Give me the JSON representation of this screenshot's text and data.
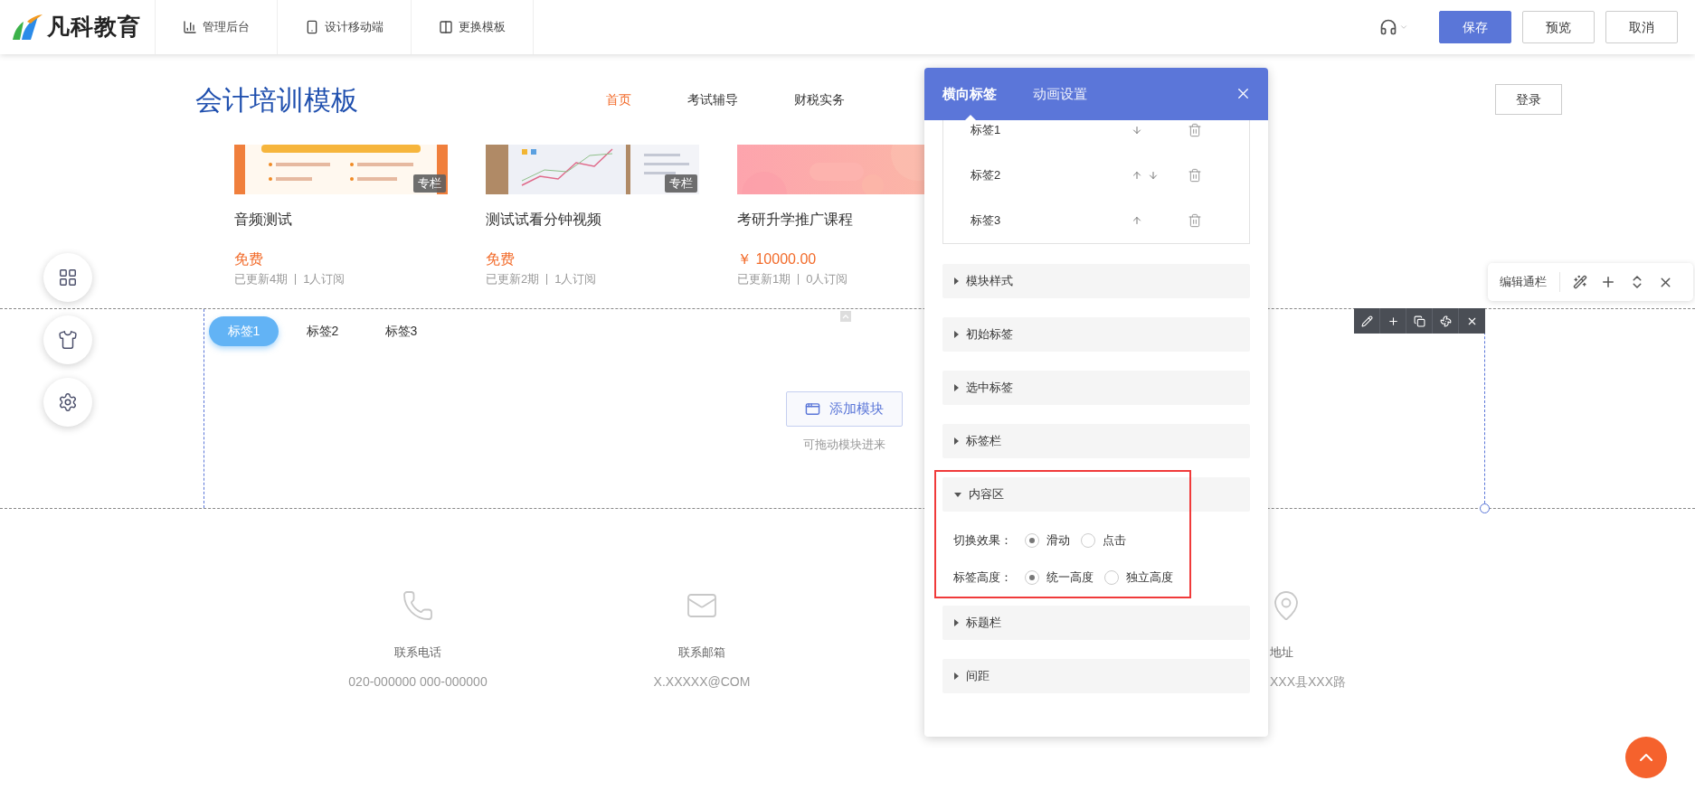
{
  "app_bar": {
    "logo": "凡科教育",
    "nav": [
      {
        "label": "管理后台",
        "kind": "stats"
      },
      {
        "label": "设计移动端",
        "kind": "mobile"
      },
      {
        "label": "更换模板",
        "kind": "template"
      }
    ],
    "buttons": [
      {
        "label": "保存",
        "kind": "primary"
      },
      {
        "label": "预览",
        "kind": "default"
      },
      {
        "label": "取消",
        "kind": "default"
      }
    ]
  },
  "site": {
    "title": "会计培训模板",
    "nav": [
      {
        "label": "首页",
        "selected": true
      },
      {
        "label": "考试辅导",
        "selected": false
      },
      {
        "label": "财税实务",
        "selected": false
      }
    ],
    "login": "登录"
  },
  "courses": [
    {
      "title": "音频测试",
      "price": "免费",
      "updates": "已更新4期",
      "subscribers": "1人订阅",
      "badge": "专栏",
      "kind": "poster"
    },
    {
      "title": "测试试看分钟视频",
      "price": "免费",
      "updates": "已更新2期",
      "subscribers": "1人订阅",
      "badge": "专栏",
      "kind": "desk"
    },
    {
      "title": "考研升学推广课程",
      "price": "￥ 10000.00",
      "updates": "已更新1期",
      "subscribers": "0人订阅",
      "kind": "gradient"
    }
  ],
  "tab_module": {
    "tabs": [
      {
        "label": "标签1",
        "selected": true
      },
      {
        "label": "标签2",
        "selected": false
      },
      {
        "label": "标签3",
        "selected": false
      }
    ],
    "add_button": "添加模块",
    "hint": "可拖动模块进来"
  },
  "edit_bar": {
    "label": "编辑通栏"
  },
  "footer": [
    {
      "label": "联系电话",
      "value": "020-000000 000-000000",
      "kind": "phone"
    },
    {
      "label": "联系邮箱",
      "value": "X.XXXXX@COM",
      "kind": "mail"
    },
    {
      "label": "地址",
      "value": "XXX县XXX路",
      "kind": "location"
    }
  ],
  "panel": {
    "tabs": [
      {
        "label": "横向标签",
        "selected": true
      },
      {
        "label": "动画设置",
        "selected": false
      }
    ],
    "tab_items": [
      {
        "label": "标签1",
        "up": false,
        "down": true
      },
      {
        "label": "标签2",
        "up": true,
        "down": true
      },
      {
        "label": "标签3",
        "up": true,
        "down": false
      }
    ],
    "sections": [
      {
        "title": "模块样式",
        "expanded": false,
        "highlighted": false
      },
      {
        "title": "初始标签",
        "expanded": false,
        "highlighted": false
      },
      {
        "title": "选中标签",
        "expanded": false,
        "highlighted": false
      },
      {
        "title": "标签栏",
        "expanded": false,
        "highlighted": false
      },
      {
        "title": "内容区",
        "expanded": true,
        "highlighted": true,
        "fields": [
          {
            "label": "切换效果：",
            "options": [
              {
                "label": "滑动",
                "selected": true
              },
              {
                "label": "点击",
                "selected": false
              }
            ]
          },
          {
            "label": "标签高度：",
            "options": [
              {
                "label": "统一高度",
                "selected": true
              },
              {
                "label": "独立高度",
                "selected": false
              }
            ]
          }
        ]
      },
      {
        "title": "标题栏",
        "expanded": false,
        "highlighted": false
      },
      {
        "title": "间距",
        "expanded": false,
        "highlighted": false
      }
    ]
  }
}
